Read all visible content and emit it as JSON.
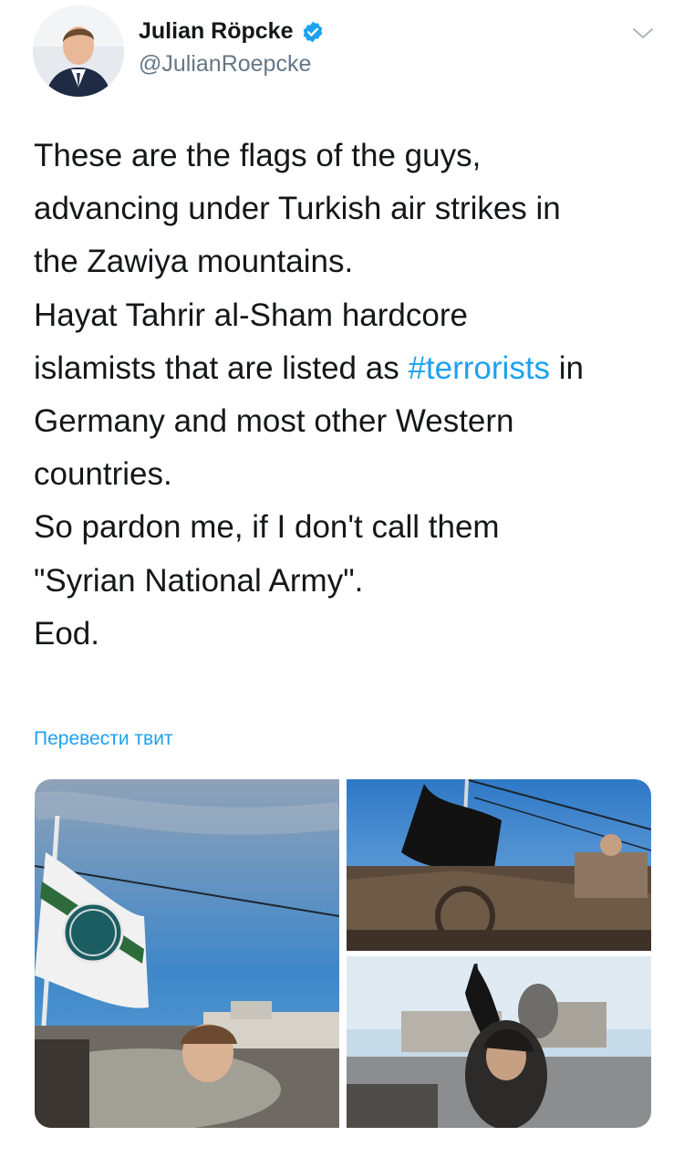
{
  "tweet": {
    "author": {
      "display_name": "Julian Röpcke",
      "handle": "@JulianRoepcke",
      "verified_icon": "verified-badge-icon"
    },
    "menu_icon": "chevron-down-icon",
    "text_lines": [
      "These are the flags of the guys,",
      "advancing under Turkish air strikes in",
      "the Zawiya mountains.",
      "Hayat Tahrir al-Sham hardcore",
      "islamists that are listed as",
      "#terrorists",
      "in",
      "Germany and most other Western",
      "countries.",
      "So pardon me, if I don't call them",
      "\"Syrian National Army\".",
      "Eod."
    ],
    "translate_link": "Перевести твит"
  },
  "colors": {
    "link": "#1da1f2",
    "text": "#14171a",
    "secondary": "#657786"
  }
}
